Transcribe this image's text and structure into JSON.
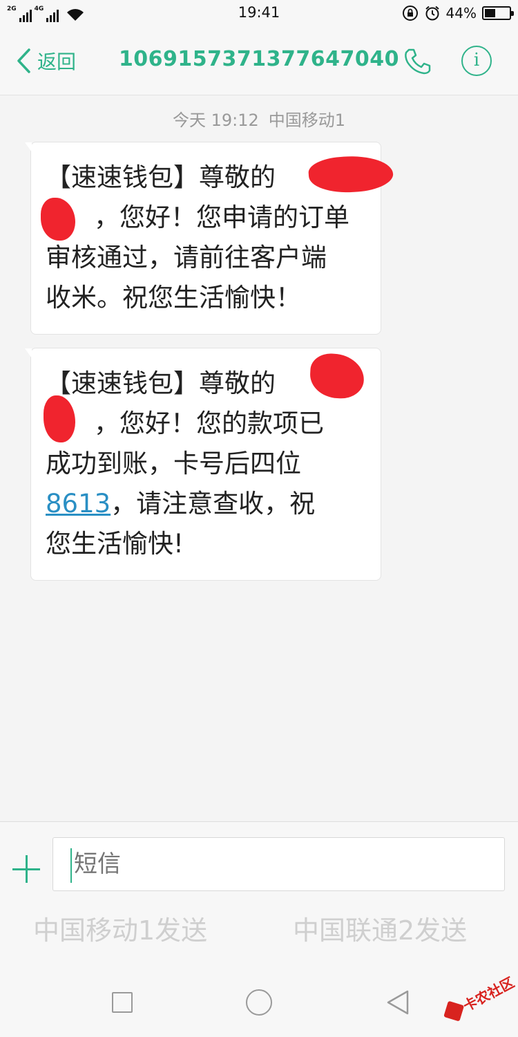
{
  "status_bar": {
    "network_1": "2G",
    "network_2": "4G",
    "time": "19:41",
    "battery_percent": "44%",
    "battery_level": 0.44,
    "icons": [
      "signal-icon",
      "wifi-icon",
      "orientation-lock-icon",
      "alarm-icon",
      "battery-icon"
    ]
  },
  "header": {
    "back_label": "返回",
    "contact_number": "1069157371377647040",
    "info_label": "i",
    "icons": [
      "back-arrow-icon",
      "phone-icon",
      "info-icon"
    ]
  },
  "conversation": {
    "timestamp_day": "今天 19:12",
    "timestamp_carrier": "中国移动1",
    "messages": [
      {
        "lines": [
          "【速速钱包】尊敬的",
          "，您好！您申请的订单",
          "审核通过，请前往客户端",
          "收米。祝您生活愉快！"
        ]
      },
      {
        "lines": [
          "【速速钱包】尊敬的",
          "，您好！您的款项已",
          "成功到账，卡号后四位",
          "，请注意查收，祝",
          "您生活愉快!"
        ],
        "card_number": "8613"
      }
    ]
  },
  "composer": {
    "placeholder": "短信",
    "send_sim1": "中国移动1发送",
    "send_sim2": "中国联通2发送"
  },
  "watermark": {
    "text": "卡农社区"
  },
  "colors": {
    "accent": "#2fb38a",
    "link": "#2a8fc4",
    "redaction": "#f0242e"
  }
}
